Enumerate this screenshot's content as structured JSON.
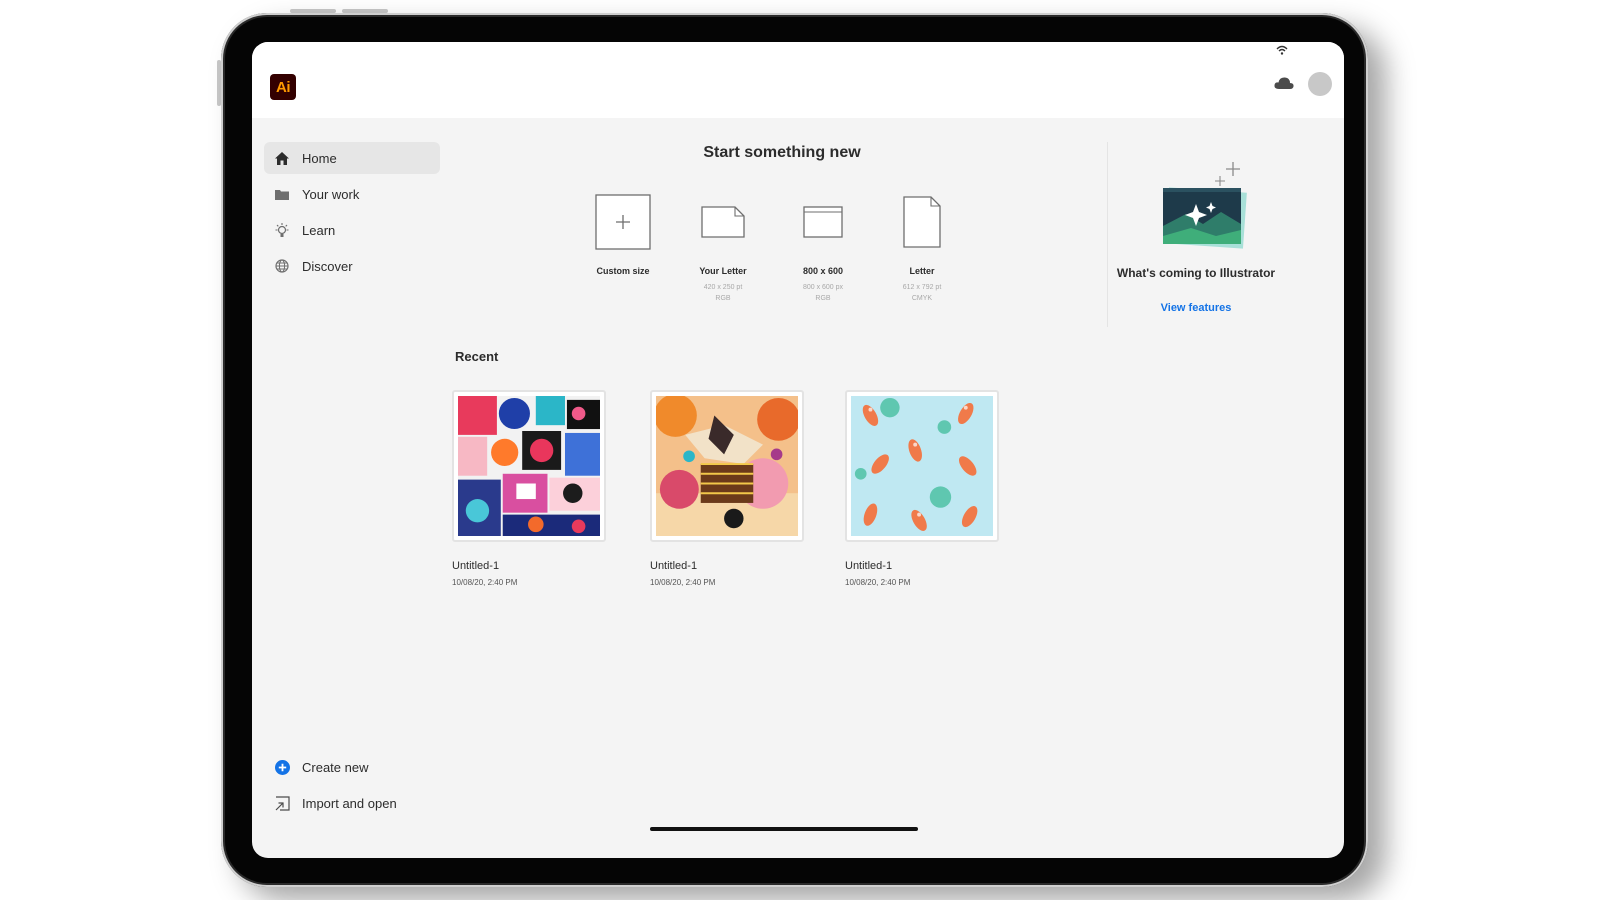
{
  "app": {
    "logo_text": "Ai"
  },
  "sidebar": {
    "items": [
      {
        "label": "Home",
        "icon": "home-icon",
        "active": true
      },
      {
        "label": "Your work",
        "icon": "folder-icon",
        "active": false
      },
      {
        "label": "Learn",
        "icon": "lightbulb-icon",
        "active": false
      },
      {
        "label": "Discover",
        "icon": "globe-icon",
        "active": false
      }
    ],
    "bottom": [
      {
        "label": "Create new",
        "icon": "plus-circle-icon"
      },
      {
        "label": "Import and open",
        "icon": "import-icon"
      }
    ]
  },
  "start": {
    "title": "Start something new",
    "presets": [
      {
        "label": "Custom size",
        "sub1": "",
        "sub2": ""
      },
      {
        "label": "Your Letter",
        "sub1": "420 x 250 pt",
        "sub2": "RGB"
      },
      {
        "label": "800 x 600",
        "sub1": "800 x 600 px",
        "sub2": "RGB"
      },
      {
        "label": "Letter",
        "sub1": "612 x 792 pt",
        "sub2": "CMYK"
      }
    ]
  },
  "promo": {
    "title": "What's coming to Illustrator",
    "link": "View features"
  },
  "recent": {
    "title": "Recent",
    "files": [
      {
        "name": "Untitled-1",
        "date": "10/08/20, 2:40 PM"
      },
      {
        "name": "Untitled-1",
        "date": "10/08/20, 2:40 PM"
      },
      {
        "name": "Untitled-1",
        "date": "10/08/20, 2:40 PM"
      }
    ]
  },
  "colors": {
    "accent": "#1473e6",
    "logo_bg": "#330000",
    "logo_fg": "#ff9a00"
  }
}
